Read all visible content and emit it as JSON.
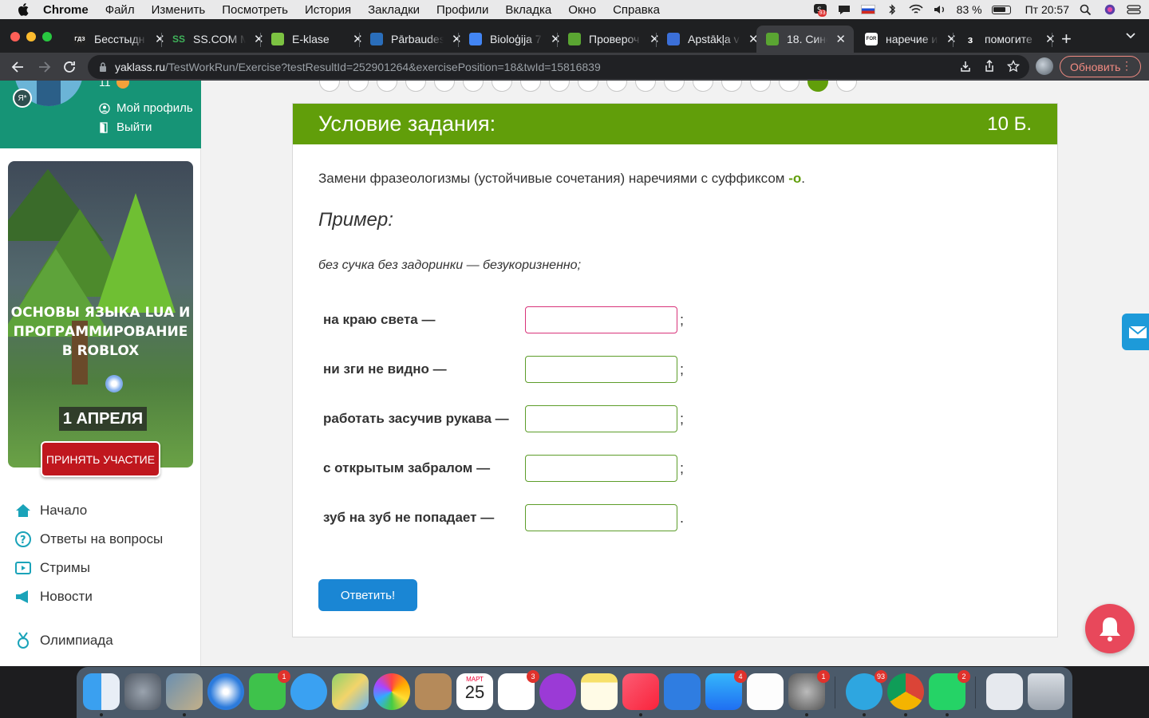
{
  "menubar": {
    "items": [
      "Chrome",
      "Файл",
      "Изменить",
      "Посмотреть",
      "История",
      "Закладки",
      "Профили",
      "Вкладка",
      "Окно",
      "Справка"
    ],
    "battery": "83 %",
    "clock": "Пт 20:57",
    "notification_count": "93"
  },
  "tabs": [
    {
      "title": "Бесстыдн",
      "favicon": "ГДЗ",
      "fav_color": "#222222"
    },
    {
      "title": "SS.COM M",
      "favicon": "SS",
      "fav_color": "#1a7a3e"
    },
    {
      "title": "E-klase",
      "favicon": "E",
      "fav_color": "#7cc242"
    },
    {
      "title": "Pārbaudes",
      "favicon": "",
      "fav_color": "#2a6ebb"
    },
    {
      "title": "Bioloģija 7",
      "favicon": "",
      "fav_color": "#4285f4"
    },
    {
      "title": "Провероч",
      "favicon": "",
      "fav_color": "#5aa532"
    },
    {
      "title": "Apstākļa v",
      "favicon": "",
      "fav_color": "#3b6fd8"
    },
    {
      "title": "18. Синон",
      "favicon": "",
      "fav_color": "#5aa532"
    },
    {
      "title": "наречие и",
      "favicon": "FOR",
      "fav_color": "#444444"
    },
    {
      "title": "помогите",
      "favicon": "з",
      "fav_color": "#222222"
    }
  ],
  "address": {
    "host": "yaklass.ru",
    "path": "/TestWorkRun/Exercise?testResultId=252901264&exercisePosition=18&twId=15816839",
    "update_label": "Обновить"
  },
  "sidebar": {
    "level": "11",
    "profile_link": "Мой профиль",
    "logout_link": "Выйти",
    "badge": "Я*",
    "banner": {
      "title_line1": "ОСНОВЫ ЯЗЫКА LUA И",
      "title_line2": "ПРОГРАММИРОВАНИЕ",
      "title_line3": "В ROBLOX",
      "date": "1 АПРЕЛЯ",
      "cta": "ПРИНЯТЬ УЧАСТИЕ"
    },
    "nav": [
      {
        "label": "Начало",
        "icon": "home-icon"
      },
      {
        "label": "Ответы на вопросы",
        "icon": "question-icon"
      },
      {
        "label": "Стримы",
        "icon": "play-icon"
      },
      {
        "label": "Новости",
        "icon": "megaphone-icon"
      },
      {
        "label": "Олимпиада",
        "icon": "medal-icon"
      }
    ]
  },
  "task": {
    "header_title": "Условие задания:",
    "points": "10 Б.",
    "instruction_prefix": "Замени фразеологизмы (устойчивые сочетания) наречиями с суффиксом ",
    "suffix": "-о",
    "instruction_end": ".",
    "example_heading": "Пример:",
    "example_text": "без сучка без задоринки — безукоризненно;",
    "questions": [
      {
        "label": "на краю света —",
        "value": "",
        "punct": ";"
      },
      {
        "label": "ни зги не видно —",
        "value": "",
        "punct": ";"
      },
      {
        "label": "работать засучив рукава —",
        "value": "",
        "punct": ";"
      },
      {
        "label": "с открытым забралом —",
        "value": "",
        "punct": ";"
      },
      {
        "label": "зуб на зуб не попадает —",
        "value": "",
        "punct": "."
      }
    ],
    "submit_label": "Ответить!"
  },
  "dock": {
    "calendar_month": "МАРТ",
    "calendar_day": "25",
    "badges": {
      "facetime": "1",
      "reminders": "3",
      "appstore": "4",
      "settings": "1",
      "telegram": "93",
      "whatsapp": "2"
    }
  },
  "colors": {
    "header_green": "#619e0a",
    "sidebar_teal": "#169476",
    "button_blue": "#1a86d4",
    "focus_pink": "#d8337a"
  }
}
